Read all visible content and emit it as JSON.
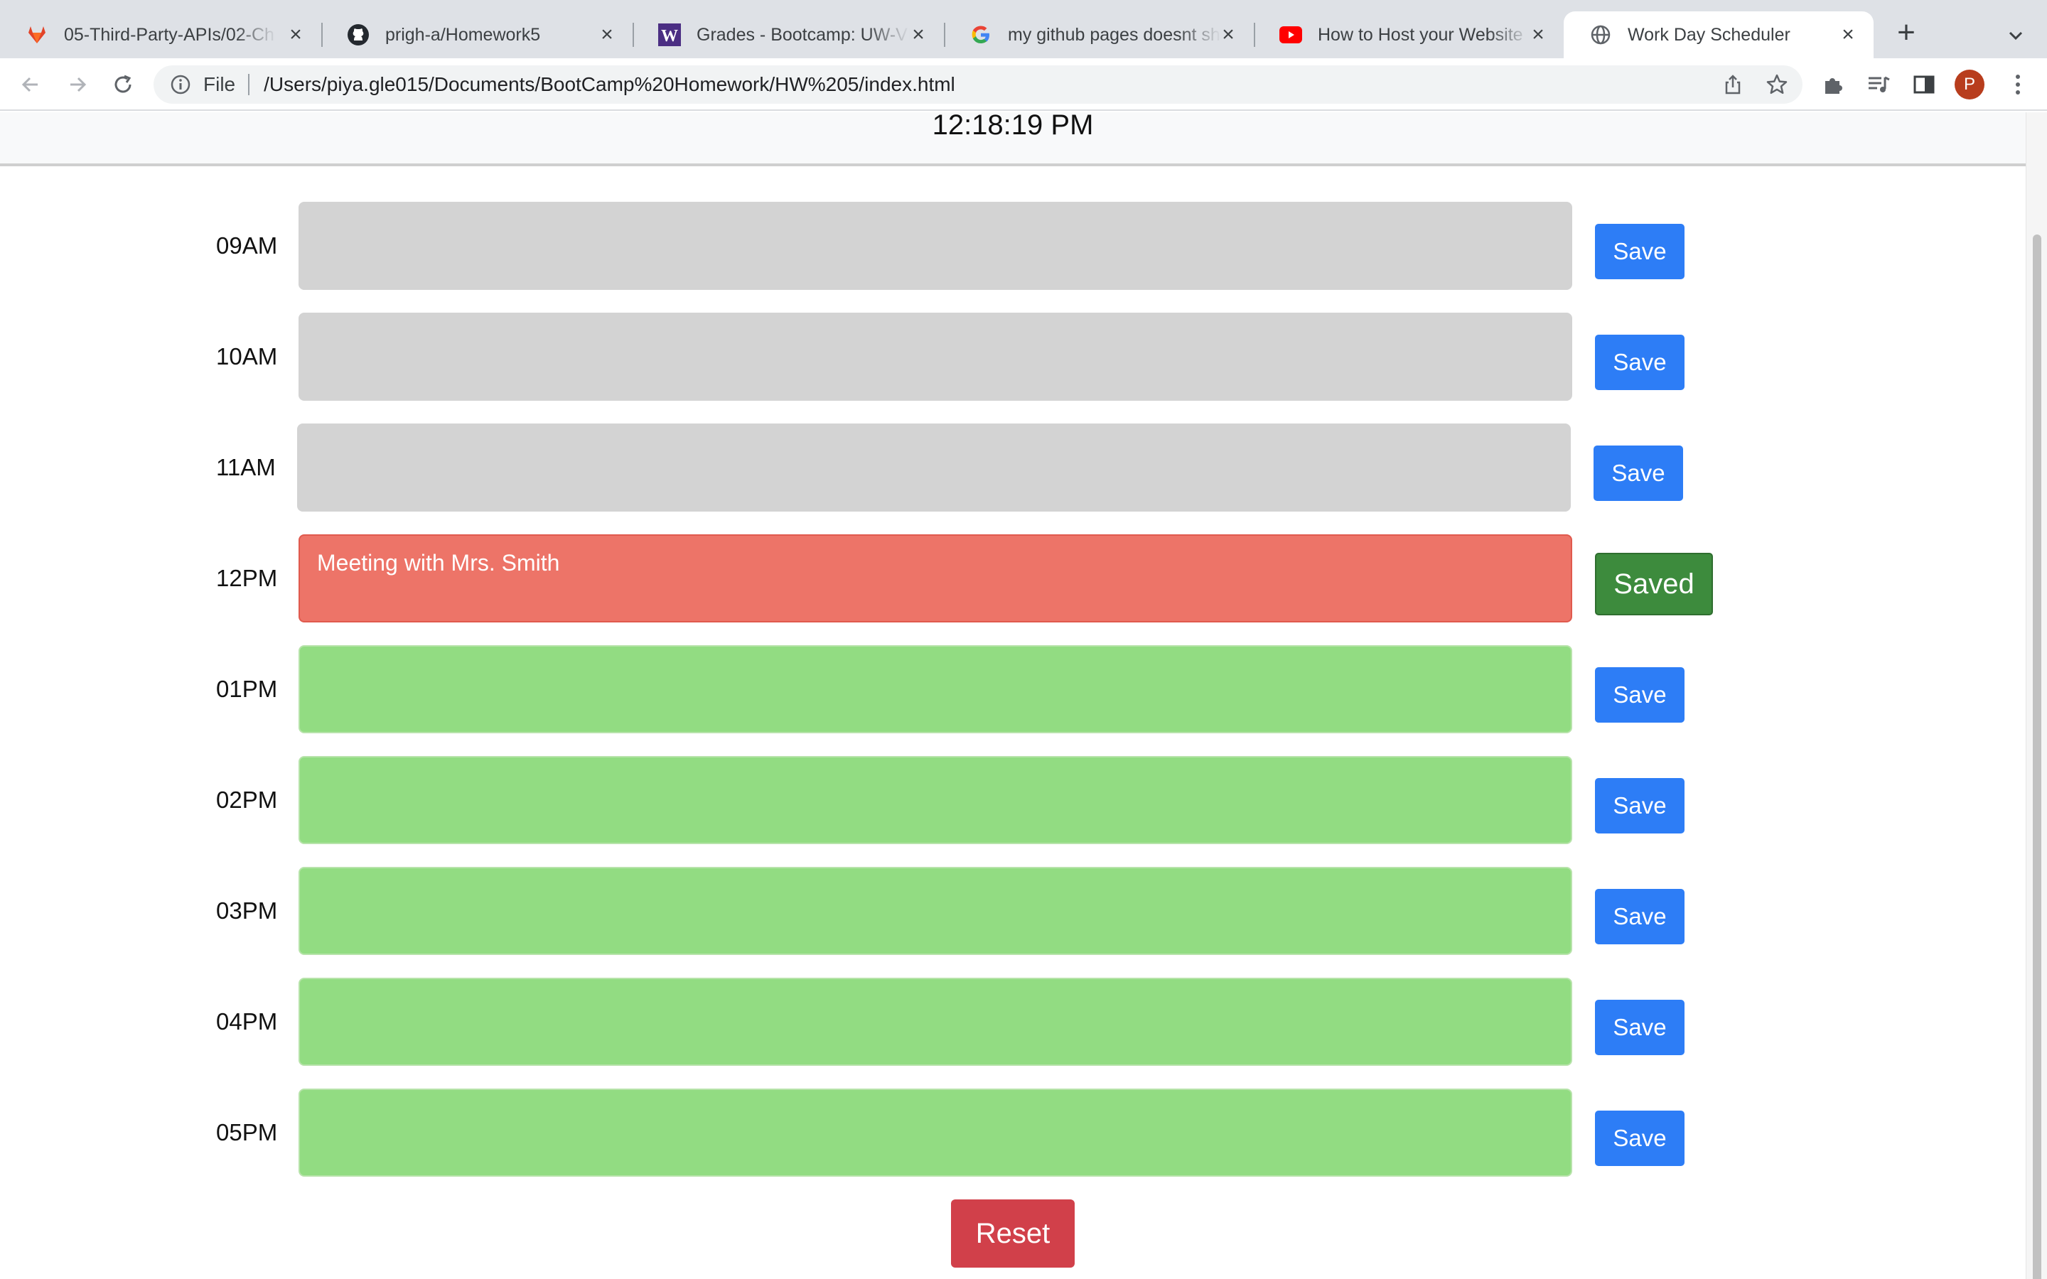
{
  "browser": {
    "tabs": [
      {
        "label": "05-Third-Party-APIs/02-Ch",
        "icon": "gitlab-icon"
      },
      {
        "label": "prigh-a/Homework5",
        "icon": "github-icon"
      },
      {
        "label": "Grades - Bootcamp: UW-VI",
        "icon": "uw-icon"
      },
      {
        "label": "my github pages doesnt sh",
        "icon": "google-icon"
      },
      {
        "label": "How to Host your Website",
        "icon": "youtube-icon"
      },
      {
        "label": "Work Day Scheduler",
        "icon": "globe-icon",
        "active": true
      }
    ],
    "close_glyph": "×",
    "new_tab_glyph": "+",
    "scheme_label": "File",
    "url": "/Users/piya.gle015/Documents/BootCamp%20Homework/HW%205/index.html",
    "profile_initial": "P"
  },
  "page": {
    "current_time": "12:18:19 PM",
    "time_blocks": [
      {
        "hour": "09AM",
        "state": "past",
        "text": "",
        "button": "Save"
      },
      {
        "hour": "10AM",
        "state": "past",
        "text": "",
        "button": "Save"
      },
      {
        "hour": "11AM",
        "state": "past",
        "text": "",
        "button": "Save"
      },
      {
        "hour": "12PM",
        "state": "present",
        "text": "Meeting with Mrs. Smith",
        "button": "Saved"
      },
      {
        "hour": "01PM",
        "state": "future",
        "text": "",
        "button": "Save"
      },
      {
        "hour": "02PM",
        "state": "future",
        "text": "",
        "button": "Save"
      },
      {
        "hour": "03PM",
        "state": "future",
        "text": "",
        "button": "Save"
      },
      {
        "hour": "04PM",
        "state": "future",
        "text": "",
        "button": "Save"
      },
      {
        "hour": "05PM",
        "state": "future",
        "text": "",
        "button": "Save"
      }
    ],
    "reset_label": "Reset"
  },
  "colors": {
    "past": "#d3d3d3",
    "present": "#ed7468",
    "future": "#92dc82",
    "save_button": "#2d7df6",
    "saved_button": "#3d8b3d",
    "reset_button": "#d1404a"
  }
}
